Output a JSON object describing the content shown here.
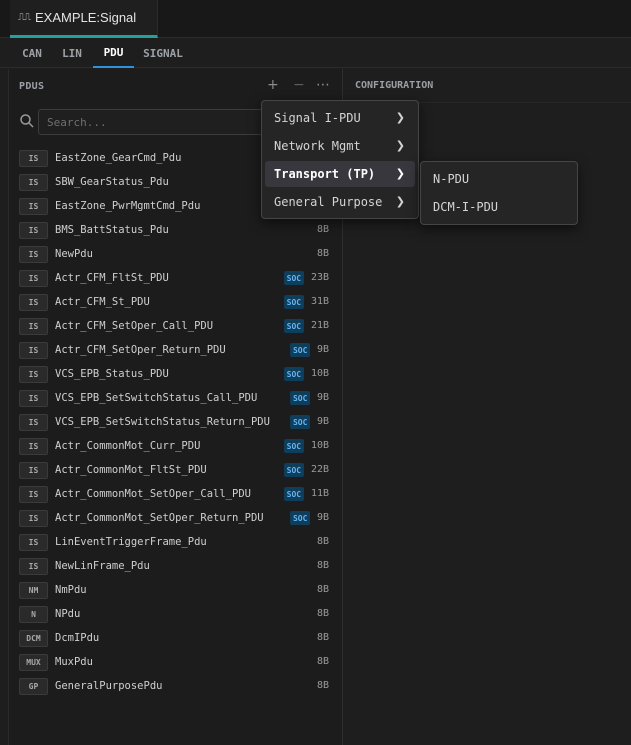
{
  "editor_tab": {
    "icon": "signal-wave-icon",
    "title": "EXAMPLE:Signal"
  },
  "protocol_tabs": [
    {
      "label": "CAN"
    },
    {
      "label": "LIN"
    },
    {
      "label": "PDU",
      "active": true
    },
    {
      "label": "SIGNAL"
    }
  ],
  "pdus_panel": {
    "title": "PDUS",
    "add_label": "+",
    "remove_label": "−",
    "more_label": "⋯",
    "search_placeholder": "Search...",
    "items": [
      {
        "tag": "IS",
        "name": "EastZone_GearCmd_Pdu",
        "soc": "",
        "size": ""
      },
      {
        "tag": "IS",
        "name": "SBW_GearStatus_Pdu",
        "soc": "",
        "size": ""
      },
      {
        "tag": "IS",
        "name": "EastZone_PwrMgmtCmd_Pdu",
        "soc": "",
        "size": ""
      },
      {
        "tag": "IS",
        "name": "BMS_BattStatus_Pdu",
        "soc": "",
        "size": "8B"
      },
      {
        "tag": "IS",
        "name": "NewPdu",
        "soc": "",
        "size": "8B"
      },
      {
        "tag": "IS",
        "name": "Actr_CFM_FltSt_PDU",
        "soc": "SOC",
        "size": "23B"
      },
      {
        "tag": "IS",
        "name": "Actr_CFM_St_PDU",
        "soc": "SOC",
        "size": "31B"
      },
      {
        "tag": "IS",
        "name": "Actr_CFM_SetOper_Call_PDU",
        "soc": "SOC",
        "size": "21B"
      },
      {
        "tag": "IS",
        "name": "Actr_CFM_SetOper_Return_PDU",
        "soc": "SOC",
        "size": "9B"
      },
      {
        "tag": "IS",
        "name": "VCS_EPB_Status_PDU",
        "soc": "SOC",
        "size": "10B"
      },
      {
        "tag": "IS",
        "name": "VCS_EPB_SetSwitchStatus_Call_PDU",
        "soc": "SOC",
        "size": "9B"
      },
      {
        "tag": "IS",
        "name": "VCS_EPB_SetSwitchStatus_Return_PDU",
        "soc": "SOC",
        "size": "9B"
      },
      {
        "tag": "IS",
        "name": "Actr_CommonMot_Curr_PDU",
        "soc": "SOC",
        "size": "10B"
      },
      {
        "tag": "IS",
        "name": "Actr_CommonMot_FltSt_PDU",
        "soc": "SOC",
        "size": "22B"
      },
      {
        "tag": "IS",
        "name": "Actr_CommonMot_SetOper_Call_PDU",
        "soc": "SOC",
        "size": "11B"
      },
      {
        "tag": "IS",
        "name": "Actr_CommonMot_SetOper_Return_PDU",
        "soc": "SOC",
        "size": "9B"
      },
      {
        "tag": "IS",
        "name": "LinEventTriggerFrame_Pdu",
        "soc": "",
        "size": "8B"
      },
      {
        "tag": "IS",
        "name": "NewLinFrame_Pdu",
        "soc": "",
        "size": "8B"
      },
      {
        "tag": "NM",
        "name": "NmPdu",
        "soc": "",
        "size": "8B"
      },
      {
        "tag": "N",
        "name": "NPdu",
        "soc": "",
        "size": "8B"
      },
      {
        "tag": "DCM",
        "name": "DcmIPdu",
        "soc": "",
        "size": "8B"
      },
      {
        "tag": "MUX",
        "name": "MuxPdu",
        "soc": "",
        "size": "8B"
      },
      {
        "tag": "GP",
        "name": "GeneralPurposePdu",
        "soc": "",
        "size": "8B"
      }
    ]
  },
  "config_panel": {
    "title": "CONFIGURATION"
  },
  "add_menu": {
    "items": [
      {
        "label": "Signal I-PDU",
        "chevron": "❯"
      },
      {
        "label": "Network Mgmt",
        "chevron": "❯"
      },
      {
        "label": "Transport (TP)",
        "chevron": "❯",
        "hover": true
      },
      {
        "label": "General Purpose",
        "chevron": "❯"
      }
    ]
  },
  "transport_submenu": {
    "items": [
      {
        "label": "N-PDU"
      },
      {
        "label": "DCM-I-PDU"
      }
    ]
  },
  "colors": {
    "accent_teal": "#1fa39b",
    "accent_blue": "#2f8fe0",
    "soc_badge_bg": "#0f3d5c",
    "soc_badge_text": "#63b4ef"
  }
}
